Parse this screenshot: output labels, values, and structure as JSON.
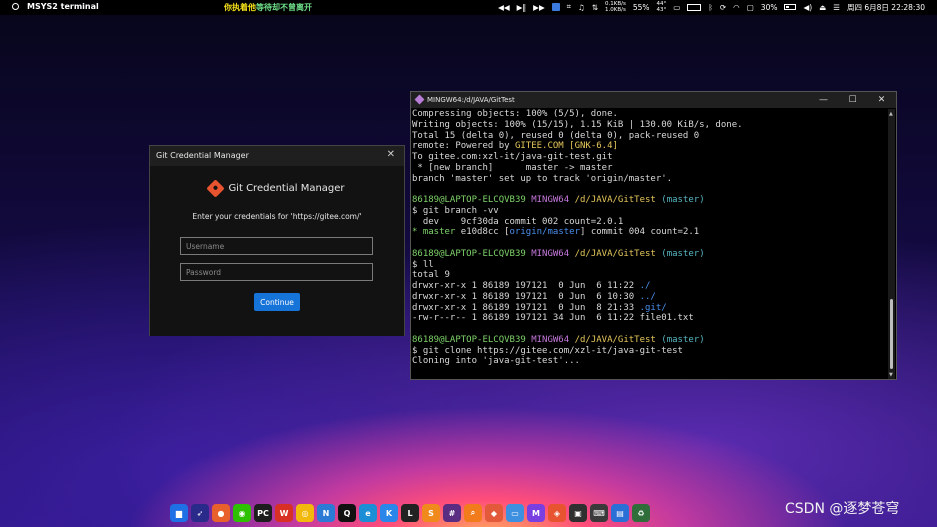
{
  "topbar": {
    "app_name": "MSYS2 terminal",
    "marquee_a": "你执着他",
    "marquee_b": "等待却不曾离开",
    "net_up": "0.1KB/s",
    "net_down": "1.0KB/s",
    "cpu": "55%",
    "temp_a": "44°",
    "temp_b": "43°",
    "battery": "30%",
    "datetime": "周四 6月8日 22:28:30"
  },
  "gcm": {
    "window_title": "Git Credential Manager",
    "heading": "Git Credential Manager",
    "prompt": "Enter your credentials for 'https://gitee.com/'",
    "username_placeholder": "Username",
    "password_placeholder": "Password",
    "continue_label": "Continue"
  },
  "terminal": {
    "title": "MINGW64:/d/JAVA/GitTest",
    "minimize": "—",
    "maximize": "☐",
    "close": "✕",
    "lines": [
      {
        "text": "Compressing objects: 100% (5/5), done."
      },
      {
        "text": "Writing objects: 100% (15/15), 1.15 KiB | 130.00 KiB/s, done."
      },
      {
        "text": "Total 15 (delta 0), reused 0 (delta 0), pack-reused 0"
      },
      {
        "segments": [
          {
            "t": "remote: Powered by "
          },
          {
            "t": "GITEE.COM",
            "c": "y"
          },
          {
            "t": " "
          },
          {
            "t": "[GNK-6.4]",
            "c": "y"
          }
        ]
      },
      {
        "text": "To gitee.com:xzl-it/java-git-test.git"
      },
      {
        "text": " * [new branch]      master -> master"
      },
      {
        "text": "branch 'master' set up to track 'origin/master'."
      },
      {
        "text": ""
      },
      {
        "segments": [
          {
            "t": "86189@LAPTOP-ELCQVB39 ",
            "c": "g"
          },
          {
            "t": "MINGW64 ",
            "c": "m"
          },
          {
            "t": "/d/JAVA/GitTest ",
            "c": "y"
          },
          {
            "t": "(master)",
            "c": "c"
          }
        ]
      },
      {
        "text": "$ git branch -vv"
      },
      {
        "text": "  dev    9cf30da commit 002 count=2.0.1"
      },
      {
        "segments": [
          {
            "t": "* ",
            "c": "g"
          },
          {
            "t": "master",
            "c": "g"
          },
          {
            "t": " e10d8cc ["
          },
          {
            "t": "origin/master",
            "c": "b"
          },
          {
            "t": "] commit 004 count=2.1"
          }
        ]
      },
      {
        "text": ""
      },
      {
        "segments": [
          {
            "t": "86189@LAPTOP-ELCQVB39 ",
            "c": "g"
          },
          {
            "t": "MINGW64 ",
            "c": "m"
          },
          {
            "t": "/d/JAVA/GitTest ",
            "c": "y"
          },
          {
            "t": "(master)",
            "c": "c"
          }
        ]
      },
      {
        "text": "$ ll"
      },
      {
        "text": "total 9"
      },
      {
        "segments": [
          {
            "t": "drwxr-xr-x 1 86189 197121  0 Jun  6 11:22 "
          },
          {
            "t": "./",
            "c": "b"
          }
        ]
      },
      {
        "segments": [
          {
            "t": "drwxr-xr-x 1 86189 197121  0 Jun  6 10:30 "
          },
          {
            "t": "../",
            "c": "b"
          }
        ]
      },
      {
        "segments": [
          {
            "t": "drwxr-xr-x 1 86189 197121  0 Jun  8 21:33 "
          },
          {
            "t": ".git/",
            "c": "b"
          }
        ]
      },
      {
        "text": "-rw-r--r-- 1 86189 197121 34 Jun  6 11:22 file01.txt"
      },
      {
        "text": ""
      },
      {
        "segments": [
          {
            "t": "86189@LAPTOP-ELCQVB39 ",
            "c": "g"
          },
          {
            "t": "MINGW64 ",
            "c": "m"
          },
          {
            "t": "/d/JAVA/GitTest ",
            "c": "y"
          },
          {
            "t": "(master)",
            "c": "c"
          }
        ]
      },
      {
        "text": "$ git clone https://gitee.com/xzl-it/java-git-test"
      },
      {
        "text": "Cloning into 'java-git-test'..."
      }
    ],
    "scroll_position": 0.72
  },
  "dock": {
    "items": [
      {
        "name": "finder-icon",
        "color": "#1f6fe5",
        "glyph": "▆"
      },
      {
        "name": "launchpad-icon",
        "color": "#2a2a8a",
        "glyph": "➶"
      },
      {
        "name": "firefox-icon",
        "color": "#e8612c",
        "glyph": "●"
      },
      {
        "name": "wechat-icon",
        "color": "#2dc100",
        "glyph": "◉"
      },
      {
        "name": "pycharm-icon",
        "color": "#1d1d1d",
        "glyph": "PC"
      },
      {
        "name": "wps-icon",
        "color": "#d93025",
        "glyph": "W"
      },
      {
        "name": "chrome-icon",
        "color": "#f2b90c",
        "glyph": "◎"
      },
      {
        "name": "notes-icon",
        "color": "#2b7bd6",
        "glyph": "N"
      },
      {
        "name": "qq-icon",
        "color": "#111111",
        "glyph": "Q"
      },
      {
        "name": "edge-icon",
        "color": "#1c8ed6",
        "glyph": "e"
      },
      {
        "name": "kugou-icon",
        "color": "#2a86e8",
        "glyph": "K"
      },
      {
        "name": "lark-icon",
        "color": "#222222",
        "glyph": "L"
      },
      {
        "name": "sublime-icon",
        "color": "#f08a1c",
        "glyph": "S"
      },
      {
        "name": "slack-icon",
        "color": "#5a2d82",
        "glyph": "#"
      },
      {
        "name": "search-icon",
        "color": "#f27b1c",
        "glyph": "⌕"
      },
      {
        "name": "sourcetree-icon",
        "color": "#e35a3a",
        "glyph": "◆"
      },
      {
        "name": "folder-icon",
        "color": "#3d8fe0",
        "glyph": "▭"
      },
      {
        "name": "mail-icon",
        "color": "#7a3fe0",
        "glyph": "M"
      },
      {
        "name": "git-icon",
        "color": "#e8542f",
        "glyph": "◈"
      },
      {
        "name": "terminal-icon",
        "color": "#303030",
        "glyph": "▣"
      },
      {
        "name": "keyboard-icon",
        "color": "#3a3a3a",
        "glyph": "⌨"
      },
      {
        "name": "preview-icon",
        "color": "#2a6fd6",
        "glyph": "▤"
      },
      {
        "name": "trash-icon",
        "color": "#2f6e3a",
        "glyph": "♻"
      }
    ]
  },
  "watermark": "CSDN @逐梦苍穹"
}
